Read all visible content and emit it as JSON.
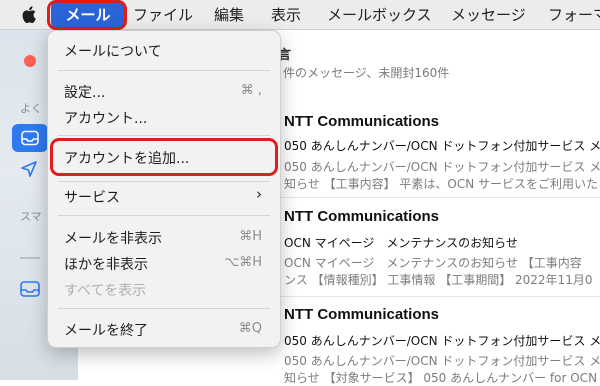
{
  "menubar": {
    "apple": "",
    "items": [
      "メール",
      "ファイル",
      "編集",
      "表示",
      "メールボックス",
      "メッセージ",
      "フォーマ"
    ]
  },
  "sidebar": {
    "section1": "よく",
    "section2": "スマ"
  },
  "mailbox": {
    "title": "言",
    "subtitle": "件のメッセージ、未開封160件"
  },
  "messages": [
    {
      "sender": "NTT Communications",
      "subject": "050 あんしんナンバー/OCN ドットフォン付加サービス メ",
      "preview1": "050 あんしんナンバー/OCN ドットフォン付加サービス メ",
      "preview2": "知らせ 【工事内容】 平素は、OCN サービスをご利用いた"
    },
    {
      "sender": "NTT Communications",
      "subject": "OCN マイページ　メンテナンスのお知らせ",
      "preview1": "OCN マイページ　メンテナンスのお知らせ 【工事内容",
      "preview2": "ンス 【情報種別】 工事情報 【工事期間】 2022年11月0"
    },
    {
      "sender": "NTT Communications",
      "subject": "050 あんしんナンバー/OCN ドットフォン付加サービス メ",
      "preview1": "050 あんしんナンバー/OCN ドットフォン付加サービス メ",
      "preview2": "知らせ 【対象サービス】 050 あんしんナンバー for OCN"
    }
  ],
  "menu": {
    "about": "メールについて",
    "settings": "設定...",
    "settings_shortcut": "⌘ ,",
    "accounts": "アカウント...",
    "add_account": "アカウントを追加...",
    "services": "サービス",
    "services_chevron": "›",
    "hide": "メールを非表示",
    "hide_shortcut": "⌘H",
    "hide_others": "ほかを非表示",
    "hide_others_shortcut": "⌥⌘H",
    "show_all": "すべてを表示",
    "quit": "メールを終了",
    "quit_shortcut": "⌘Q"
  },
  "colors": {
    "accent": "#2b63d9",
    "highlight_box": "#e11c1c",
    "sidebar_active": "#2e7af0",
    "close_button": "#fe5f57"
  }
}
